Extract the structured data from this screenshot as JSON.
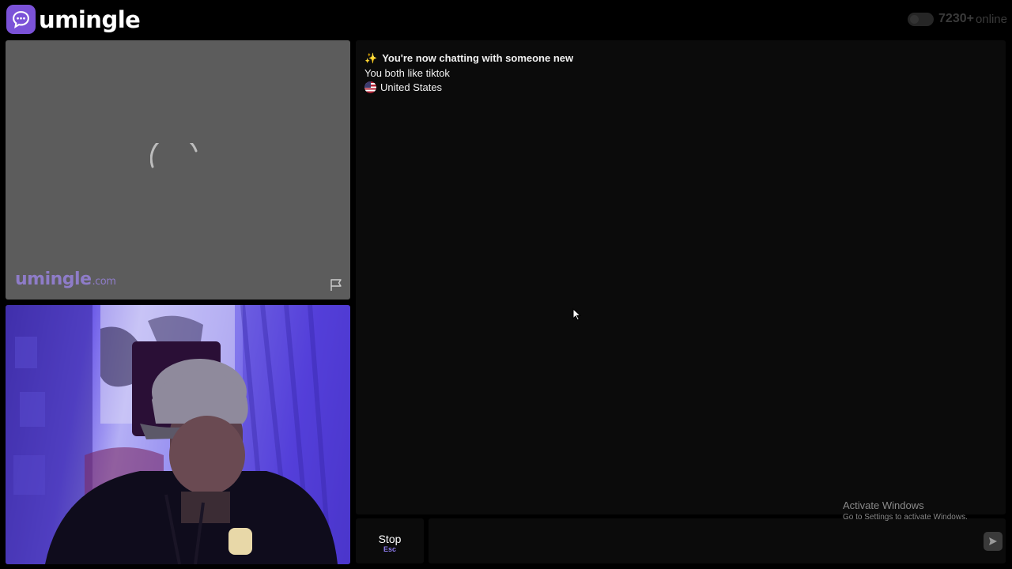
{
  "header": {
    "brand": "umingle",
    "online_count": "7230+",
    "online_label": "online"
  },
  "stranger_video": {
    "watermark_brand": "umingle",
    "watermark_domain": ".com",
    "report_icon": "flag-icon"
  },
  "chat": {
    "system_message": "You're now chatting with someone new",
    "interest_message": "You both like tiktok",
    "location": "United States",
    "sparkle_icon": "sparkle-icon",
    "flag_icon": "us-flag-icon"
  },
  "controls": {
    "stop_label": "Stop",
    "stop_shortcut": "Esc",
    "input_value": "",
    "input_placeholder": "",
    "send_icon": "send-icon"
  },
  "os_overlay": {
    "activate_title": "Activate Windows",
    "activate_subtitle": "Go to Settings to activate Windows."
  },
  "colors": {
    "brand": "#7b52d8",
    "background": "#000000",
    "panel": "#0b0b0b",
    "video_placeholder": "#5c5c5c",
    "shortcut_accent": "#8e7cf0"
  }
}
